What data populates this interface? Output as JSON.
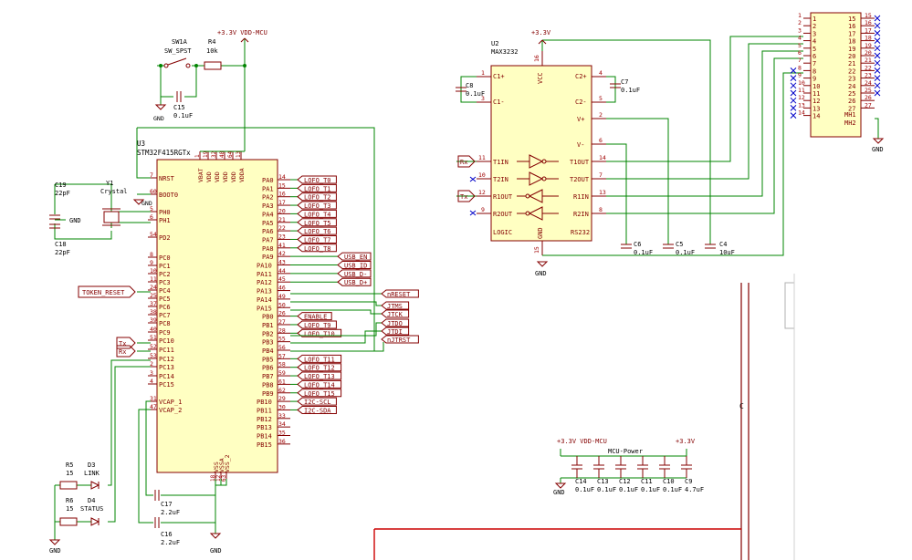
{
  "u3": {
    "ref": "U3",
    "value": "STM32F415RGTx",
    "left_pins": [
      {
        "num": "7",
        "name": "NRST"
      },
      {
        "num": "60",
        "name": "BOOT0"
      },
      {
        "num": "5",
        "name": "PH0"
      },
      {
        "num": "6",
        "name": "PH1"
      },
      {
        "num": "54",
        "name": "PD2"
      },
      {
        "num": "8",
        "name": "PC0"
      },
      {
        "num": "9",
        "name": "PC1"
      },
      {
        "num": "10",
        "name": "PC2"
      },
      {
        "num": "11",
        "name": "PC3"
      },
      {
        "num": "24",
        "name": "PC4"
      },
      {
        "num": "25",
        "name": "PC5"
      },
      {
        "num": "37",
        "name": "PC6"
      },
      {
        "num": "38",
        "name": "PC7"
      },
      {
        "num": "39",
        "name": "PC8"
      },
      {
        "num": "40",
        "name": "PC9"
      },
      {
        "num": "51",
        "name": "PC10"
      },
      {
        "num": "52",
        "name": "PC11"
      },
      {
        "num": "53",
        "name": "PC12"
      },
      {
        "num": "2",
        "name": "PC13"
      },
      {
        "num": "3",
        "name": "PC14"
      },
      {
        "num": "4",
        "name": "PC15"
      },
      {
        "num": "31",
        "name": "VCAP_1"
      },
      {
        "num": "47",
        "name": "VCAP_2"
      }
    ],
    "right_pins": [
      {
        "num": "14",
        "name": "PA0"
      },
      {
        "num": "15",
        "name": "PA1"
      },
      {
        "num": "16",
        "name": "PA2"
      },
      {
        "num": "17",
        "name": "PA3"
      },
      {
        "num": "20",
        "name": "PA4"
      },
      {
        "num": "21",
        "name": "PA5"
      },
      {
        "num": "22",
        "name": "PA6"
      },
      {
        "num": "23",
        "name": "PA7"
      },
      {
        "num": "41",
        "name": "PA8"
      },
      {
        "num": "42",
        "name": "PA9"
      },
      {
        "num": "43",
        "name": "PA10"
      },
      {
        "num": "44",
        "name": "PA11"
      },
      {
        "num": "45",
        "name": "PA12"
      },
      {
        "num": "46",
        "name": "PA13"
      },
      {
        "num": "49",
        "name": "PA14"
      },
      {
        "num": "50",
        "name": "PA15"
      },
      {
        "num": "26",
        "name": "PB0"
      },
      {
        "num": "27",
        "name": "PB1"
      },
      {
        "num": "28",
        "name": "PB2"
      },
      {
        "num": "55",
        "name": "PB3"
      },
      {
        "num": "56",
        "name": "PB4"
      },
      {
        "num": "57",
        "name": "PB5"
      },
      {
        "num": "58",
        "name": "PB6"
      },
      {
        "num": "59",
        "name": "PB7"
      },
      {
        "num": "61",
        "name": "PB8"
      },
      {
        "num": "62",
        "name": "PB9"
      },
      {
        "num": "29",
        "name": "PB10"
      },
      {
        "num": "30",
        "name": "PB11"
      },
      {
        "num": "33",
        "name": "PB12"
      },
      {
        "num": "34",
        "name": "PB13"
      },
      {
        "num": "35",
        "name": "PB14"
      },
      {
        "num": "36",
        "name": "PB15"
      }
    ],
    "top_pins": [
      {
        "num": "1",
        "name": "VBAT"
      },
      {
        "num": "19",
        "name": "VDD"
      },
      {
        "num": "32",
        "name": "VDD"
      },
      {
        "num": "48",
        "name": "VDD"
      },
      {
        "num": "64",
        "name": "VDD"
      },
      {
        "num": "13",
        "name": "VDDA"
      }
    ],
    "bottom_pins": [
      {
        "num": "18",
        "name": "VSS"
      },
      {
        "num": "12",
        "name": "VSSA"
      },
      {
        "num": "63",
        "name": "VSS_2"
      }
    ]
  },
  "right_labels": [
    {
      "row": 0,
      "text": "LOFO_T0"
    },
    {
      "row": 1,
      "text": "LOFO_T1"
    },
    {
      "row": 2,
      "text": "LOFO_T2"
    },
    {
      "row": 3,
      "text": "LOFO_T3"
    },
    {
      "row": 4,
      "text": "LOFO_T4"
    },
    {
      "row": 5,
      "text": "LOFO_T5"
    },
    {
      "row": 6,
      "text": "LOFO_T6"
    },
    {
      "row": 7,
      "text": "LOFO_T7"
    },
    {
      "row": 8,
      "text": "LOFO_T8"
    },
    {
      "row": 9,
      "text": "USB_EN"
    },
    {
      "row": 10,
      "text": "USB_ID"
    },
    {
      "row": 11,
      "text": "USB_D-"
    },
    {
      "row": 12,
      "text": "USB_D+"
    },
    {
      "row": 16,
      "text": "ENABLE"
    },
    {
      "row": 17,
      "text": "LOFO_T9"
    },
    {
      "row": 18,
      "text": "LOFO_T10"
    },
    {
      "row": 21,
      "text": "LOFO_T11"
    },
    {
      "row": 22,
      "text": "LOFO_T12"
    },
    {
      "row": 23,
      "text": "LOFO_T13"
    },
    {
      "row": 24,
      "text": "LOFO_T14"
    },
    {
      "row": 25,
      "text": "LOFO_T15"
    },
    {
      "row": 26,
      "text": "I2C-SCL"
    },
    {
      "row": 27,
      "text": "I2C-SDA"
    }
  ],
  "jtag_labels": [
    "nRESET",
    "JTMS",
    "JTCK",
    "JTDO",
    "JTDI",
    "nJTRST"
  ],
  "token_reset": "TOKEN_RESET",
  "tx_label": "Tx",
  "rx_label": "Rx",
  "sw1": {
    "ref": "SW1A",
    "value": "SW_SPST"
  },
  "r4": {
    "ref": "R4",
    "value": "10k"
  },
  "vdd_mcu_top": "+3.3V VDD-MCU",
  "c15": {
    "ref": "C15",
    "value": "0.1uF"
  },
  "y1": {
    "ref": "Y1",
    "value": "Crystal"
  },
  "c19": {
    "ref": "C19",
    "value": "22pF"
  },
  "c18": {
    "ref": "C18",
    "value": "22pF"
  },
  "gnd": "GND",
  "r5": {
    "ref": "R5",
    "value": "15"
  },
  "d3": {
    "ref": "D3",
    "value": "LINK"
  },
  "r6": {
    "ref": "R6",
    "value": "15"
  },
  "d4": {
    "ref": "D4",
    "value": "STATUS"
  },
  "c17": {
    "ref": "C17",
    "value": "2.2uF"
  },
  "c16": {
    "ref": "C16",
    "value": "2.2uF"
  },
  "u2": {
    "ref": "U2",
    "value": "MAX3232",
    "c1p": "C1+",
    "c1m": "C1-",
    "vcc": "VCC",
    "c2p": "C2+",
    "c2m": "C2-",
    "vp": "V+",
    "vm": "V-",
    "t1in": "T1IN",
    "t2in": "T2IN",
    "r1out": "R1OUT",
    "r2out": "R2OUT",
    "t1out": "T1OUT",
    "t2out": "T2OUT",
    "r1in": "R1IN",
    "r2in": "R2IN",
    "logic": "LOGIC",
    "gndp": "GND",
    "rs232": "RS232"
  },
  "u2_pins": {
    "c1p": "1",
    "c1m": "3",
    "vcc": "16",
    "c2p": "4",
    "c2m": "5",
    "vp": "2",
    "vm": "6",
    "t1in": "11",
    "t2in": "10",
    "r1out": "12",
    "r2out": "9",
    "t1out": "14",
    "t2out": "7",
    "r1in": "13",
    "r2in": "8",
    "gnd": "15"
  },
  "plus33": "+3.3V",
  "c8": {
    "ref": "C8",
    "value": "0.1uF"
  },
  "c7": {
    "ref": "C7",
    "value": "0.1uF"
  },
  "c6": {
    "ref": "C6",
    "value": "0.1uF"
  },
  "c5": {
    "ref": "C5",
    "value": "0.1uF"
  },
  "c4": {
    "ref": "C4",
    "value": "10uF"
  },
  "conn": {
    "left": [
      "1",
      "2",
      "3",
      "4",
      "5",
      "6",
      "7",
      "8",
      "9",
      "10",
      "11",
      "12",
      "13",
      "14"
    ],
    "right": [
      "15",
      "16",
      "17",
      "18",
      "19",
      "20",
      "21",
      "22",
      "23",
      "24",
      "25",
      "26",
      "27"
    ],
    "mh": [
      "MH1",
      "MH2"
    ]
  },
  "mcu_power": {
    "title": "MCU-Power",
    "vdd_mcu": "+3.3V VDD-MCU",
    "plus33": "+3.3V",
    "caps": [
      {
        "ref": "C14",
        "value": "0.1uF"
      },
      {
        "ref": "C13",
        "value": "0.1uF"
      },
      {
        "ref": "C12",
        "value": "0.1uF"
      },
      {
        "ref": "C11",
        "value": "0.1uF"
      },
      {
        "ref": "C10",
        "value": "0.1uF"
      },
      {
        "ref": "C9",
        "value": "4.7uF"
      }
    ]
  },
  "sheet_letter": "C"
}
